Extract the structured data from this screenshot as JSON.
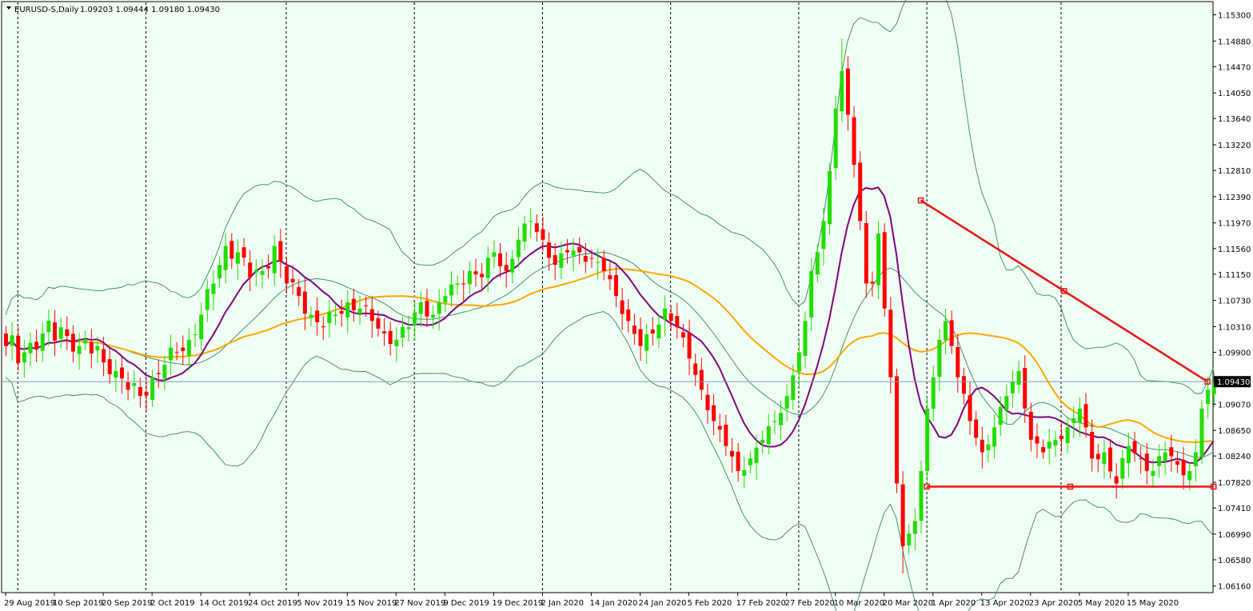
{
  "header": {
    "symbol": "EURUSD-S,Daily",
    "ohlc": "1.09203 1.09444 1.09180 1.09430"
  },
  "colors": {
    "background": "#f0fff4",
    "bull_candle": "#22dd00",
    "bear_candle": "#ff0000",
    "ma_fast": "#800080",
    "ma_slow": "#ffa500",
    "bands": "#2e8b57",
    "trendline": "#ee1111",
    "price_line": "#7aa0b0"
  },
  "chart_data": {
    "type": "candlestick",
    "symbol": "EURUSD-S",
    "timeframe": "Daily",
    "last_price": 1.0943,
    "last_price_label": "1.09430",
    "ylim": [
      1.0608,
      1.1546
    ],
    "y_ticks": [
      "1.15300",
      "1.14880",
      "1.14470",
      "1.14050",
      "1.13640",
      "1.13220",
      "1.12810",
      "1.12390",
      "1.11970",
      "1.11560",
      "1.11150",
      "1.10730",
      "1.10310",
      "1.09900",
      "1.09070",
      "1.08650",
      "1.08240",
      "1.07820",
      "1.07410",
      "1.06990",
      "1.06580",
      "1.06160"
    ],
    "x_labels": [
      {
        "label": "29 Aug 2019",
        "bar": 0
      },
      {
        "label": "10 Sep 2019",
        "bar": 8
      },
      {
        "label": "20 Sep 2019",
        "bar": 16
      },
      {
        "label": "2 Oct 2019",
        "bar": 24
      },
      {
        "label": "14 Oct 2019",
        "bar": 32
      },
      {
        "label": "24 Oct 2019",
        "bar": 40
      },
      {
        "label": "5 Nov 2019",
        "bar": 48
      },
      {
        "label": "15 Nov 2019",
        "bar": 56
      },
      {
        "label": "27 Nov 2019",
        "bar": 64
      },
      {
        "label": "9 Dec 2019",
        "bar": 72
      },
      {
        "label": "19 Dec 2019",
        "bar": 80
      },
      {
        "label": "2 Jan 2020",
        "bar": 88
      },
      {
        "label": "14 Jan 2020",
        "bar": 96
      },
      {
        "label": "24 Jan 2020",
        "bar": 104
      },
      {
        "label": "5 Feb 2020",
        "bar": 112
      },
      {
        "label": "17 Feb 2020",
        "bar": 120
      },
      {
        "label": "27 Feb 2020",
        "bar": 128
      },
      {
        "label": "10 Mar 2020",
        "bar": 136
      },
      {
        "label": "20 Mar 2020",
        "bar": 144
      },
      {
        "label": "1 Apr 2020",
        "bar": 152
      },
      {
        "label": "13 Apr 2020",
        "bar": 160
      },
      {
        "label": "23 Apr 2020",
        "bar": 168
      },
      {
        "label": "5 May 2020",
        "bar": 176
      },
      {
        "label": "15 May 2020",
        "bar": 184
      }
    ],
    "separator_bars": [
      2,
      23,
      46,
      67,
      88,
      109,
      130,
      151,
      173
    ],
    "close_anchors": [
      [
        0,
        1.1
      ],
      [
        3,
        1.099
      ],
      [
        6,
        1.102
      ],
      [
        9,
        1.103
      ],
      [
        12,
        1.1
      ],
      [
        15,
        1.1
      ],
      [
        18,
        1.096
      ],
      [
        20,
        1.093
      ],
      [
        22,
        1.092
      ],
      [
        24,
        1.095
      ],
      [
        26,
        1.097
      ],
      [
        28,
        1.099
      ],
      [
        30,
        1.101
      ],
      [
        32,
        1.105
      ],
      [
        34,
        1.11
      ],
      [
        36,
        1.116
      ],
      [
        38,
        1.115
      ],
      [
        40,
        1.111
      ],
      [
        42,
        1.112
      ],
      [
        44,
        1.116
      ],
      [
        46,
        1.11
      ],
      [
        48,
        1.108
      ],
      [
        50,
        1.105
      ],
      [
        52,
        1.103
      ],
      [
        54,
        1.105
      ],
      [
        56,
        1.107
      ],
      [
        58,
        1.106
      ],
      [
        60,
        1.104
      ],
      [
        62,
        1.102
      ],
      [
        64,
        1.101
      ],
      [
        66,
        1.103
      ],
      [
        68,
        1.107
      ],
      [
        70,
        1.105
      ],
      [
        72,
        1.108
      ],
      [
        74,
        1.11
      ],
      [
        76,
        1.112
      ],
      [
        78,
        1.111
      ],
      [
        80,
        1.115
      ],
      [
        82,
        1.112
      ],
      [
        84,
        1.117
      ],
      [
        86,
        1.12
      ],
      [
        88,
        1.117
      ],
      [
        90,
        1.113
      ],
      [
        92,
        1.115
      ],
      [
        94,
        1.115
      ],
      [
        96,
        1.114
      ],
      [
        98,
        1.112
      ],
      [
        100,
        1.108
      ],
      [
        102,
        1.104
      ],
      [
        104,
        1.1
      ],
      [
        106,
        1.102
      ],
      [
        108,
        1.106
      ],
      [
        110,
        1.103
      ],
      [
        112,
        1.098
      ],
      [
        114,
        1.093
      ],
      [
        116,
        1.088
      ],
      [
        118,
        1.084
      ],
      [
        120,
        1.08
      ],
      [
        122,
        1.082
      ],
      [
        124,
        1.085
      ],
      [
        126,
        1.088
      ],
      [
        128,
        1.092
      ],
      [
        130,
        1.099
      ],
      [
        131,
        1.104
      ],
      [
        132,
        1.112
      ],
      [
        133,
        1.115
      ],
      [
        134,
        1.12
      ],
      [
        135,
        1.128
      ],
      [
        136,
        1.138
      ],
      [
        137,
        1.144
      ],
      [
        138,
        1.137
      ],
      [
        139,
        1.129
      ],
      [
        140,
        1.12
      ],
      [
        141,
        1.11
      ],
      [
        142,
        1.11
      ],
      [
        143,
        1.118
      ],
      [
        144,
        1.106
      ],
      [
        145,
        1.095
      ],
      [
        146,
        1.078
      ],
      [
        147,
        1.068
      ],
      [
        148,
        1.07
      ],
      [
        149,
        1.072
      ],
      [
        150,
        1.08
      ],
      [
        151,
        1.09
      ],
      [
        152,
        1.095
      ],
      [
        153,
        1.101
      ],
      [
        154,
        1.104
      ],
      [
        155,
        1.1
      ],
      [
        156,
        1.095
      ],
      [
        158,
        1.088
      ],
      [
        160,
        1.083
      ],
      [
        162,
        1.087
      ],
      [
        164,
        1.092
      ],
      [
        166,
        1.096
      ],
      [
        167,
        1.09
      ],
      [
        168,
        1.085
      ],
      [
        170,
        1.083
      ],
      [
        172,
        1.085
      ],
      [
        174,
        1.087
      ],
      [
        176,
        1.09
      ],
      [
        178,
        1.082
      ],
      [
        180,
        1.083
      ],
      [
        182,
        1.078
      ],
      [
        184,
        1.084
      ],
      [
        186,
        1.082
      ],
      [
        188,
        1.08
      ],
      [
        190,
        1.083
      ],
      [
        192,
        1.081
      ],
      [
        194,
        1.08
      ],
      [
        195,
        1.083
      ],
      [
        196,
        1.09
      ],
      [
        197,
        1.093
      ],
      [
        198,
        1.0943
      ]
    ],
    "indicators": [
      {
        "name": "fast_ma",
        "color_key": "ma_fast",
        "period": 10
      },
      {
        "name": "slow_ma",
        "color_key": "ma_slow",
        "period": 34
      },
      {
        "name": "bands",
        "color_key": "bands",
        "period": 20,
        "deviations": 2
      }
    ],
    "trendlines": [
      {
        "type": "resistance",
        "from": {
          "bar": 150,
          "price": 1.1233
        },
        "to": {
          "bar": 197,
          "price": 1.0943
        }
      },
      {
        "type": "support",
        "from": {
          "bar": 151,
          "price": 1.0775
        },
        "to": {
          "bar": 198,
          "price": 1.0775
        }
      }
    ],
    "grid": false
  }
}
